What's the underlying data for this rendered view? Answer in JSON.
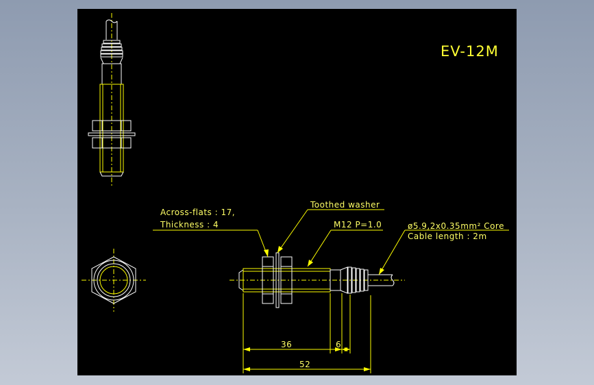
{
  "drawing": {
    "model": "EV-12M",
    "notes": {
      "across_flats_line1": "Across-flats : 17,",
      "across_flats_line2": "Thickness : 4",
      "toothed_washer": "Toothed washer",
      "thread": "M12 P=1.0",
      "cable_line1": "ø5.9,2x0.35mm² Core",
      "cable_line2": "Cable length : 2m"
    },
    "dimensions": {
      "body_length": "36",
      "cone_length": "6",
      "total_length": "52"
    }
  },
  "colors": {
    "background": "#000000",
    "drawing_yellow": "#ffff00",
    "drawing_white": "#ffffff",
    "frame_gradient_top": "#8e9bb0"
  }
}
